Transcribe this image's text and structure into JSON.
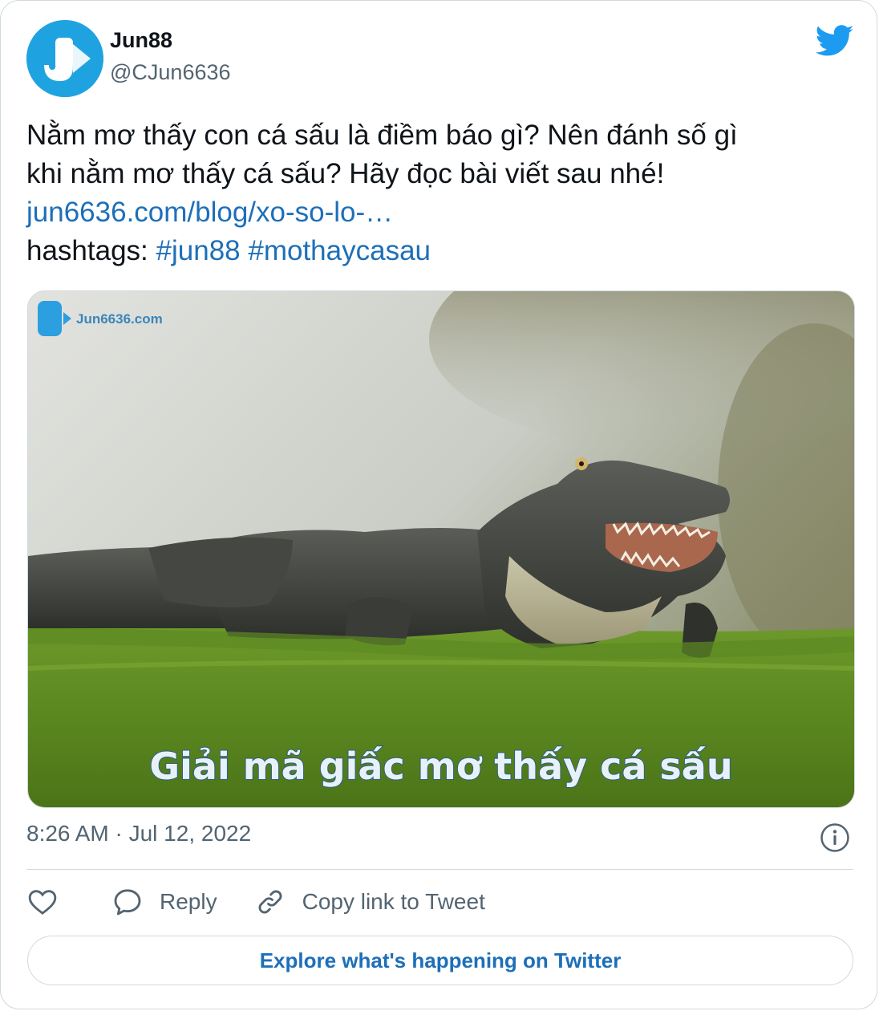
{
  "author": {
    "name": "Jun88",
    "handle": "@CJun6636",
    "avatar_letter": "J"
  },
  "tweet": {
    "line1": "Nằm mơ thấy con cá sấu là điềm báo gì? Nên đánh số gì",
    "line2": "khi nằm mơ thấy cá sấu? Hãy đọc bài viết sau nhé!",
    "link": "jun6636.com/blog/xo-so-lo-…",
    "hashtags_prefix": "hashtags:",
    "hashtags": [
      "#jun88",
      "#mothaycasau"
    ]
  },
  "media": {
    "watermark": "Jun6636.com",
    "caption": "Giải mã giấc mơ thấy cá sấu"
  },
  "meta": {
    "timestamp": "8:26 AM · Jul 12, 2022"
  },
  "actions": {
    "reply_label": "Reply",
    "copy_label": "Copy link to Tweet"
  },
  "explore_label": "Explore what's happening on Twitter",
  "icons": {
    "brand": "twitter-bird-icon",
    "info": "info-icon",
    "like": "heart-icon",
    "reply": "speech-bubble-icon",
    "copy": "link-icon"
  },
  "colors": {
    "link": "#1d6fb8",
    "secondary_text": "#536471",
    "border": "#cfd9de",
    "twitter_blue": "#1d9bf0",
    "avatar_blue": "#1fa3e0"
  }
}
